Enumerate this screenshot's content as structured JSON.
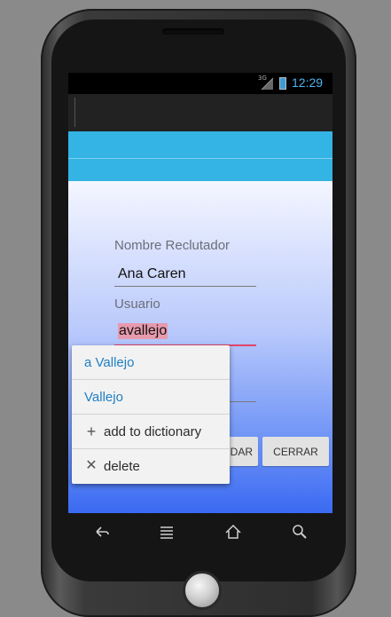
{
  "status_bar": {
    "network": "3G",
    "time": "12:29"
  },
  "form": {
    "recruiter_label": "Nombre Reclutador",
    "recruiter_value": "Ana Caren",
    "user_label": "Usuario",
    "user_value": "avallejo"
  },
  "buttons": {
    "partial_button_label": "DAR",
    "close_label": "CERRAR"
  },
  "suggestion_popup": {
    "items": [
      {
        "label": "a Vallejo",
        "style": "suggestion"
      },
      {
        "label": "Vallejo",
        "style": "suggestion"
      },
      {
        "label": "add to dictionary",
        "icon": "plus-icon"
      },
      {
        "label": "delete",
        "icon": "x-icon"
      }
    ]
  },
  "nav_bar": {
    "icons": [
      "back-icon",
      "menu-icon",
      "home-icon",
      "search-icon"
    ]
  },
  "colors": {
    "accent_blue": "#34b4e4",
    "time_blue": "#4fb3f0",
    "suggestion_blue": "#1f7fc4",
    "highlight_pink": "#e79aae",
    "error_underline": "#e0456b"
  }
}
